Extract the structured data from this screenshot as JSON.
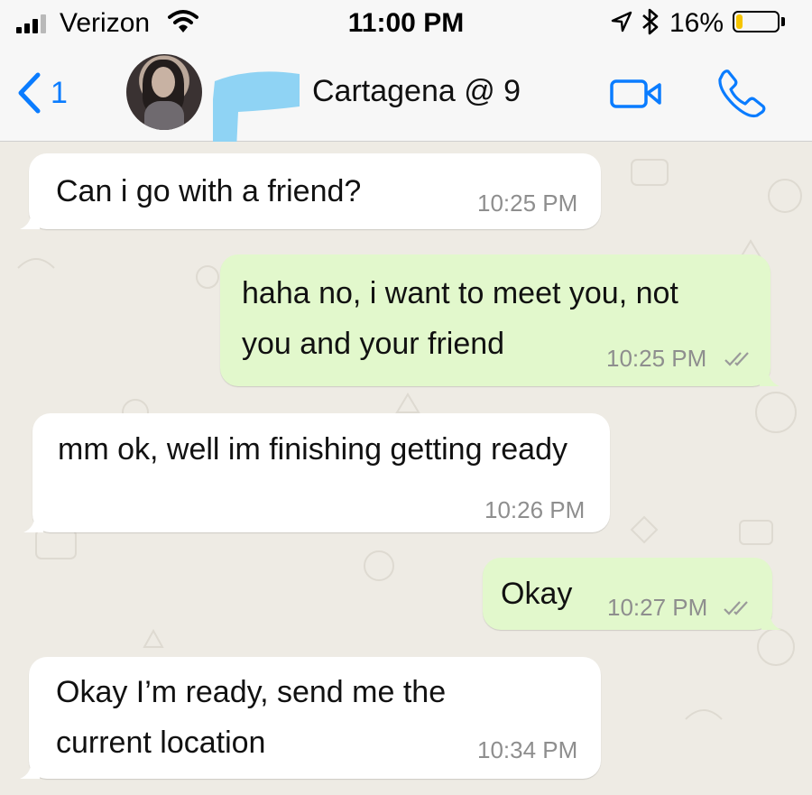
{
  "status_bar": {
    "carrier": "Verizon",
    "time": "11:00 PM",
    "battery_percent": "16%",
    "battery_level": 0.16,
    "icons": [
      "signal-bars-icon",
      "wifi-icon",
      "location-arrow-icon",
      "bluetooth-icon",
      "battery-icon"
    ]
  },
  "header": {
    "back_count": "1",
    "contact_name": "Cartagena @ 9",
    "icons": [
      "back-chevron-icon",
      "video-call-icon",
      "phone-call-icon"
    ]
  },
  "messages": [
    {
      "direction": "incoming",
      "text": "Can i go with a friend?",
      "time": "10:25 PM",
      "read": false
    },
    {
      "direction": "outgoing",
      "text": "haha no, i want to meet you, not\nyou and your friend",
      "time": "10:25 PM",
      "read": true
    },
    {
      "direction": "incoming",
      "text": "mm ok, well im finishing getting ready",
      "time": "10:26 PM",
      "read": false
    },
    {
      "direction": "outgoing",
      "text": "Okay",
      "time": "10:27 PM",
      "read": true
    },
    {
      "direction": "incoming",
      "text": "Okay I’m ready, send me the\ncurrent location",
      "time": "10:34 PM",
      "read": false
    }
  ],
  "colors": {
    "accent": "#0a7cff",
    "incoming_bubble": "#ffffff",
    "outgoing_bubble": "#e2f8cc",
    "chat_background": "#eeebe4",
    "battery_fill": "#f6c500",
    "redaction_mark": "#8fd3f4"
  }
}
